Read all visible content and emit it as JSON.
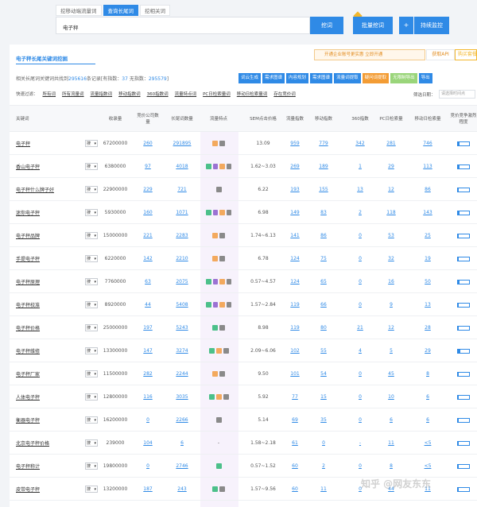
{
  "tabs": [
    "挖移动端流量词",
    "查询长尾词",
    "挖相关词"
  ],
  "search": {
    "value": "电子秤"
  },
  "buttons": {
    "dig": "挖词",
    "batch": "批量挖词",
    "plus": "+",
    "monitor": "持续监控"
  },
  "panel": {
    "title": "电子秤长尾关键词挖掘",
    "notice": "开通企业账号更实惠 立即开通",
    "getapi": "获取API",
    "buypkg": "购买套餐",
    "summary_prefix": "相关长尾词关键词共找到",
    "summary_count": "295616",
    "summary_mid": "条记录[有指数：",
    "summary_index": "37",
    "summary_mid2": " 无指数：",
    "summary_noindex": "295579",
    "summary_end": "]"
  },
  "toolbar": [
    {
      "label": "词云生成",
      "color": "blue"
    },
    {
      "label": "需求图谱",
      "color": "blue"
    },
    {
      "label": "内容规划",
      "color": "blue"
    },
    {
      "label": "需求图谱",
      "color": "blue"
    },
    {
      "label": "流量词提取",
      "color": "blue"
    },
    {
      "label": "疑问词提取",
      "color": "orange"
    },
    {
      "label": "无限制导出",
      "color": "green"
    },
    {
      "label": "导出",
      "color": "blue"
    }
  ],
  "filters": {
    "label": "快速过滤：",
    "items": [
      "所有词",
      "所有流量词",
      "流量指数词",
      "移动指数词",
      "360指数词",
      "流量特点词",
      "PC日检索量词",
      "移动日检索量词",
      "存在竞价词"
    ],
    "date_label": "筛选日期：",
    "date_placeholder": "请选择时间点"
  },
  "columns": [
    "关键词",
    "收录量",
    "竞价公司数量",
    "长尾词数量",
    "流量特点",
    "SEM点击价格",
    "流量指数",
    "移动指数",
    "360指数",
    "PC日检索量",
    "移动日检索量",
    "竞价竞争激烈程度"
  ],
  "dropdown_label": "搜",
  "rows": [
    {
      "kw": "电子秤",
      "rec": "67200000",
      "bid": "260",
      "lt": "291895",
      "tags": [
        "#f3a95e",
        "#8a8a8a"
      ],
      "sem": "13.09",
      "flow": "959",
      "mob": "779",
      "s360": "342",
      "pc": "281",
      "mday": "746",
      "comp": 0.15
    },
    {
      "kw": "香山电子秤",
      "rec": "6380000",
      "bid": "97",
      "lt": "4018",
      "tags": [
        "#4cc08a",
        "#9b72d3",
        "#f3a95e",
        "#8a8a8a"
      ],
      "sem": "1.62~3.03",
      "flow": "269",
      "mob": "189",
      "s360": "1",
      "pc": "29",
      "mday": "113",
      "comp": 0.12
    },
    {
      "kw": "电子秤什么牌子好",
      "rec": "22900000",
      "bid": "229",
      "lt": "721",
      "tags": [
        "#8a8a8a"
      ],
      "sem": "6.22",
      "flow": "193",
      "mob": "155",
      "s360": "13",
      "pc": "12",
      "mday": "86",
      "comp": 0.1
    },
    {
      "kw": "迷你电子秤",
      "rec": "5930000",
      "bid": "160",
      "lt": "1071",
      "tags": [
        "#4cc08a",
        "#9b72d3",
        "#f3a95e",
        "#8a8a8a"
      ],
      "sem": "6.98",
      "flow": "149",
      "mob": "83",
      "s360": "2",
      "pc": "118",
      "mday": "143",
      "comp": 0.15
    },
    {
      "kw": "电子秤品牌",
      "rec": "15000000",
      "bid": "221",
      "lt": "2283",
      "tags": [
        "#f3a95e",
        "#8a8a8a"
      ],
      "sem": "1.74~6.13",
      "flow": "141",
      "mob": "86",
      "s360": "0",
      "pc": "53",
      "mday": "25",
      "comp": 0.1
    },
    {
      "kw": "手提电子秤",
      "rec": "6220000",
      "bid": "142",
      "lt": "2210",
      "tags": [
        "#f3a95e",
        "#8a8a8a"
      ],
      "sem": "6.78",
      "flow": "124",
      "mob": "75",
      "s360": "0",
      "pc": "32",
      "mday": "19",
      "comp": 0.1
    },
    {
      "kw": "电子秤原理",
      "rec": "7760000",
      "bid": "63",
      "lt": "2075",
      "tags": [
        "#4cc08a",
        "#9b72d3",
        "#f3a95e",
        "#8a8a8a"
      ],
      "sem": "0.57~4.57",
      "flow": "124",
      "mob": "65",
      "s360": "0",
      "pc": "16",
      "mday": "50",
      "comp": 0.12
    },
    {
      "kw": "电子秤校准",
      "rec": "8920000",
      "bid": "44",
      "lt": "5408",
      "tags": [
        "#4cc08a",
        "#9b72d3",
        "#f3a95e",
        "#8a8a8a"
      ],
      "sem": "1.57~2.84",
      "flow": "119",
      "mob": "66",
      "s360": "0",
      "pc": "9",
      "mday": "13",
      "comp": 0.1
    },
    {
      "kw": "电子秤价格",
      "rec": "25000000",
      "bid": "197",
      "lt": "5243",
      "tags": [
        "#4cc08a",
        "#8a8a8a"
      ],
      "sem": "8.98",
      "flow": "119",
      "mob": "80",
      "s360": "21",
      "pc": "12",
      "mday": "28",
      "comp": 0.1
    },
    {
      "kw": "电子秤维修",
      "rec": "13300000",
      "bid": "147",
      "lt": "3274",
      "tags": [
        "#4cc08a",
        "#f3a95e",
        "#8a8a8a"
      ],
      "sem": "2.09~6.06",
      "flow": "102",
      "mob": "55",
      "s360": "4",
      "pc": "5",
      "mday": "29",
      "comp": 0.2
    },
    {
      "kw": "电子秤厂家",
      "rec": "11500000",
      "bid": "282",
      "lt": "2244",
      "tags": [
        "#f3a95e",
        "#8a8a8a"
      ],
      "sem": "9.50",
      "flow": "101",
      "mob": "54",
      "s360": "0",
      "pc": "45",
      "mday": "8",
      "comp": 0.1
    },
    {
      "kw": "人体电子秤",
      "rec": "12800000",
      "bid": "116",
      "lt": "3035",
      "tags": [
        "#4cc08a",
        "#f3a95e",
        "#8a8a8a"
      ],
      "sem": "5.92",
      "flow": "77",
      "mob": "15",
      "s360": "0",
      "pc": "10",
      "mday": "6",
      "comp": 0.1
    },
    {
      "kw": "衡器电子秤",
      "rec": "16200000",
      "bid": "0",
      "lt": "2266",
      "tags": [
        "#8a8a8a"
      ],
      "sem": "5.14",
      "flow": "69",
      "mob": "35",
      "s360": "0",
      "pc": "6",
      "mday": "6",
      "comp": 0.1
    },
    {
      "kw": "北京电子秤价格",
      "rec": "239000",
      "bid": "104",
      "lt": "6",
      "tags": [],
      "sem": "1.58~2.18",
      "flow": "61",
      "mob": "0",
      "s360": "-",
      "pc": "11",
      "mday": "<5",
      "comp": 0.1
    },
    {
      "kw": "电子秤称计",
      "rec": "19800000",
      "bid": "0",
      "lt": "2746",
      "tags": [
        "#4cc08a"
      ],
      "sem": "0.57~1.52",
      "flow": "60",
      "mob": "2",
      "s360": "0",
      "pc": "8",
      "mday": "<5",
      "comp": 0.1
    },
    {
      "kw": "皮带电子秤",
      "rec": "13200000",
      "bid": "187",
      "lt": "243",
      "tags": [
        "#4cc08a",
        "#8a8a8a"
      ],
      "sem": "1.57~9.56",
      "flow": "60",
      "mob": "11",
      "s360": "0",
      "pc": "44",
      "mday": "11",
      "comp": 0.1
    }
  ],
  "watermark": "知乎 @网友东东"
}
